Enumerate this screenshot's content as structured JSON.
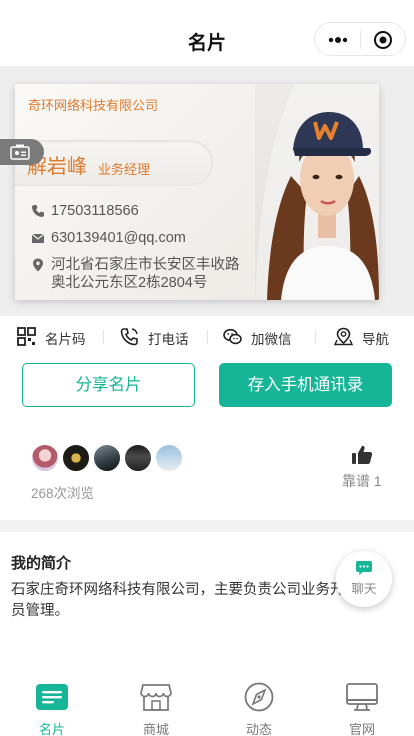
{
  "header": {
    "title": "名片"
  },
  "capsule": {
    "more_icon": "more-dots-icon",
    "target_icon": "target-icon"
  },
  "card": {
    "company": "奇环网络科技有限公司",
    "name": "解岩峰",
    "title": "业务经理",
    "phone": "17503118566",
    "email": "630139401@qq.com",
    "address_line1": "河北省石家庄市长安区丰收路",
    "address_line2": "奥北公元东区2栋2804号",
    "accent_color": "#e07a2c"
  },
  "actions": [
    {
      "label": "名片码",
      "icon": "qr-code-icon"
    },
    {
      "label": "打电话",
      "icon": "phone-call-icon"
    },
    {
      "label": "加微信",
      "icon": "wechat-icon"
    },
    {
      "label": "导航",
      "icon": "map-pin-icon"
    }
  ],
  "buttons": {
    "share": "分享名片",
    "save": "存入手机通讯录",
    "brand_color": "#16b597"
  },
  "stats": {
    "views": "268次浏览",
    "like": "靠谱 1"
  },
  "intro": {
    "title": "我的简介",
    "text": "石家庄奇环网络科技有限公司，主要负责公司业务开展和人员管理。"
  },
  "chat": {
    "label": "聊天"
  },
  "tabs": [
    {
      "label": "名片",
      "icon": "card-icon",
      "active": true
    },
    {
      "label": "商城",
      "icon": "shop-icon",
      "active": false
    },
    {
      "label": "动态",
      "icon": "compass-icon",
      "active": false
    },
    {
      "label": "官网",
      "icon": "monitor-icon",
      "active": false
    }
  ]
}
